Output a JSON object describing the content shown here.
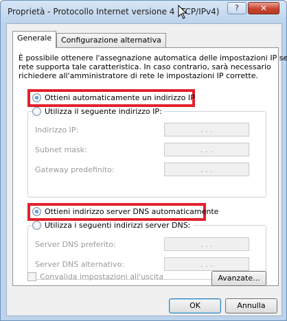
{
  "window": {
    "title": "Proprietà - Protocollo Internet versione 4 (TCP/IPv4)",
    "help_glyph": "?",
    "close_glyph": "✕"
  },
  "tabs": [
    {
      "label": "Generale",
      "active": true
    },
    {
      "label": "Configurazione alternativa",
      "active": false
    }
  ],
  "description": [
    "È possibile ottenere l'assegnazione automatica delle impostazioni IP se la",
    "rete supporta tale caratteristica. In caso contrario, sarà necessario",
    "richiedere all'amministratore di rete le impostazioni IP corrette."
  ],
  "ip": {
    "auto_label": "Ottieni automaticamente un indirizzo IP",
    "auto_selected": true,
    "manual_label": "Utilizza il seguente indirizzo IP:",
    "fields": [
      {
        "label": "Indirizzo IP:",
        "value": ". . ."
      },
      {
        "label": "Subnet mask:",
        "value": ". . ."
      },
      {
        "label": "Gateway predefinito:",
        "value": ". . ."
      }
    ]
  },
  "dns": {
    "auto_label": "Ottieni indirizzo server DNS automaticamente",
    "auto_selected": true,
    "manual_label": "Utilizza i seguenti indirizzi server DNS:",
    "fields": [
      {
        "label": "Server DNS preferito:",
        "value": ". . ."
      },
      {
        "label": "Server DNS alternativo:",
        "value": ". . ."
      }
    ]
  },
  "validate_label": "Convalida impostazioni all'uscita",
  "validate_checked": false,
  "buttons": {
    "advanced": "Avanzate...",
    "ok": "OK",
    "cancel": "Annulla"
  },
  "colors": {
    "highlight": "#e3202b",
    "title_bar": "#bcd3ec",
    "disabled_text": "#9a9a9a"
  }
}
